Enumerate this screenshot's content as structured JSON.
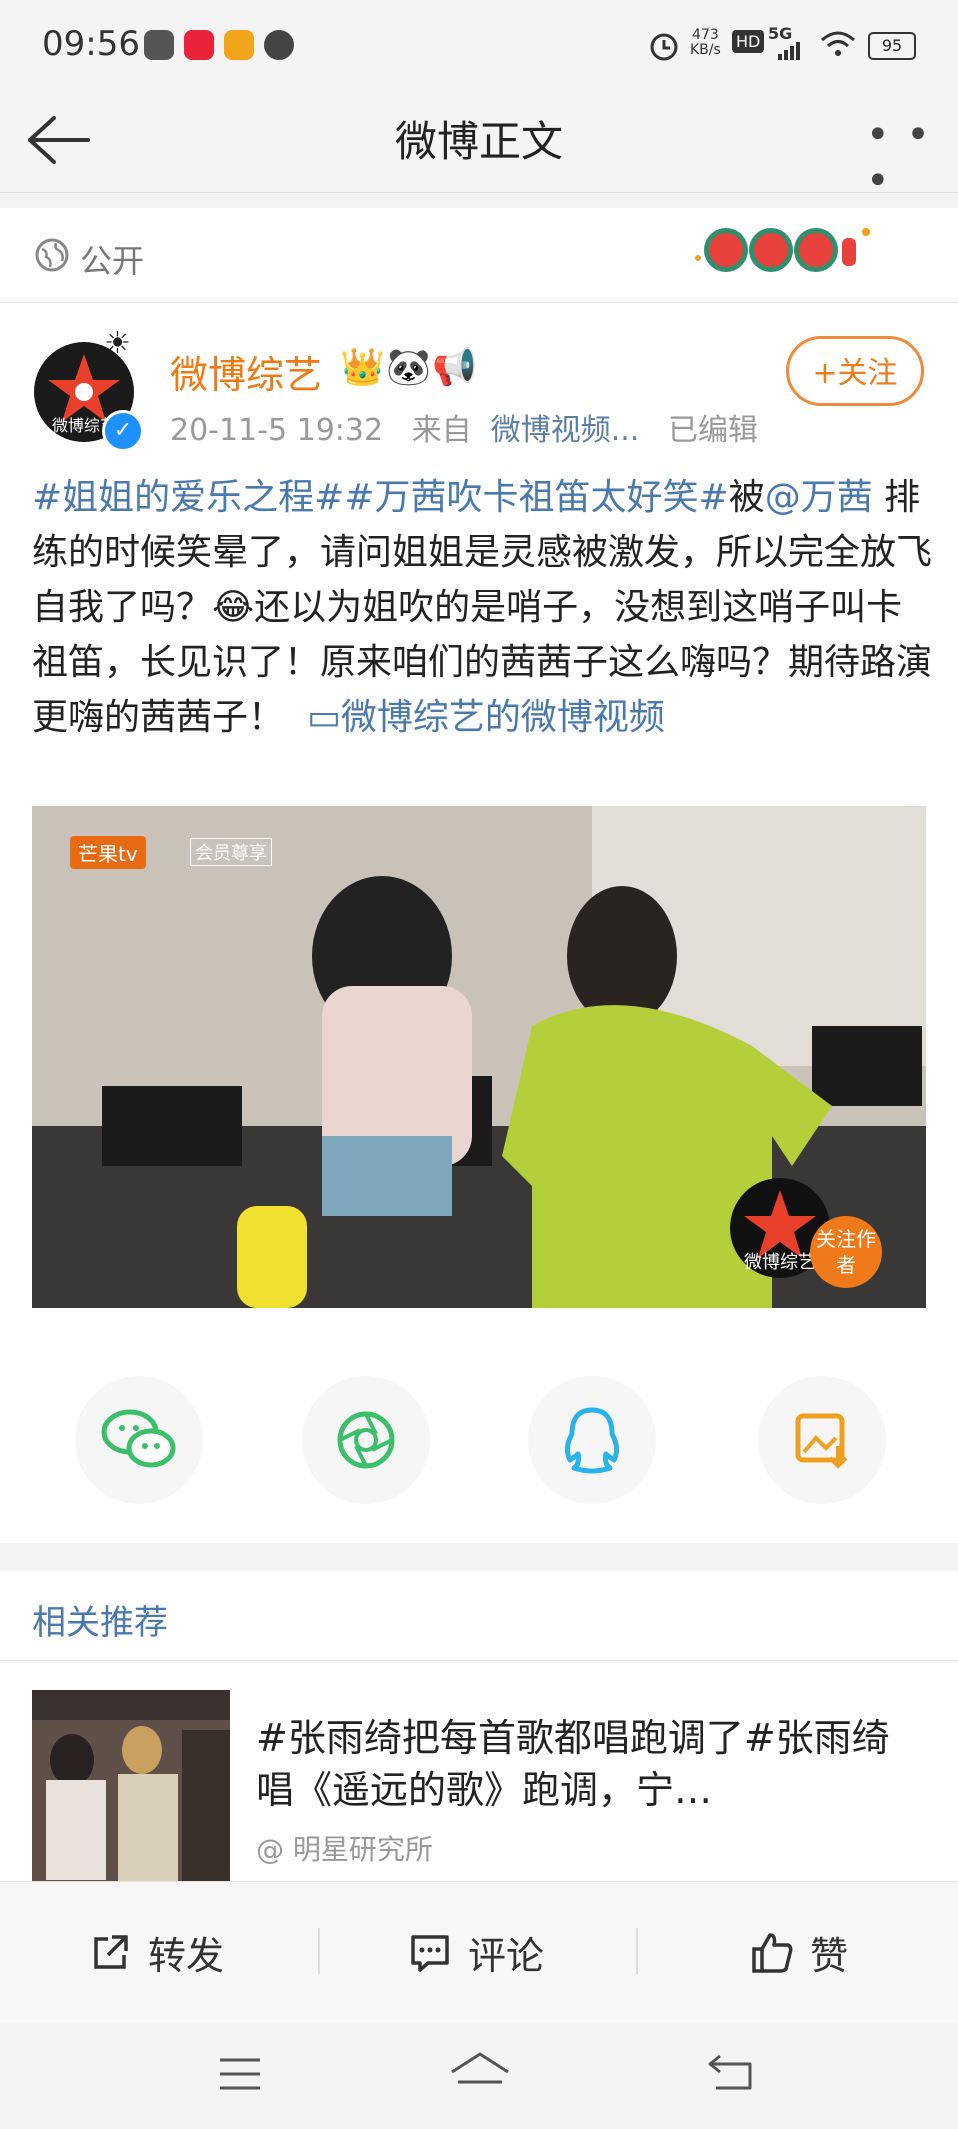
{
  "status": {
    "time": "09:56",
    "speed": "473",
    "speed_unit": "KB/s",
    "hd": "HD",
    "net": "5G",
    "battery": "95"
  },
  "header": {
    "title": "微博正文",
    "back_icon": "back-arrow-icon",
    "more": "• • •"
  },
  "visibility": {
    "label": "公开"
  },
  "post": {
    "author": "微博综艺",
    "emojis": [
      "👑",
      "🐼",
      "📢"
    ],
    "date": "20-11-5 19:32",
    "from_prefix": "来自",
    "source": "微博视频...",
    "edited": "已编辑",
    "follow_label": "+关注",
    "avatar_text": "微博综艺",
    "content": {
      "topic1": "#姐姐的爱乐之程#",
      "topic2": "#万茜吹卡祖笛太好笑#",
      "pre_mention": "被",
      "mention": "@万茜",
      "body1": " 排练的时候笑晕了，请问姐姐是灵感被激发，所以完全放飞自我了吗？",
      "body_emoji": "😂",
      "body2": "还以为姐吹的是哨子，没想到这哨子叫卡祖笛，长见识了！原来咱们的茜茜子这么嗨吗？期待路演更嗨的茜茜子！",
      "video_link": "微博综艺的微博视频"
    },
    "video": {
      "channel": "芒果tv",
      "channel_tag": "会员尊享",
      "watermark": "微博综艺",
      "follow_author": "关注作者"
    },
    "share_icons": [
      "wechat-icon",
      "moments-icon",
      "qq-icon",
      "save-image-icon"
    ]
  },
  "related": {
    "title": "相关推荐",
    "item": {
      "text": "#张雨绮把每首歌都唱跑调了#张雨绮唱《遥远的歌》跑调，宁…",
      "source": "@ 明星研究所"
    }
  },
  "actions": {
    "repost": "转发",
    "comment": "评论",
    "like": "赞"
  }
}
